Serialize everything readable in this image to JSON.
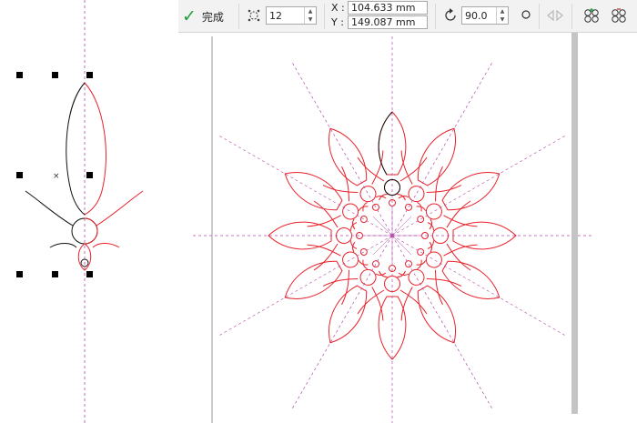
{
  "toolbar": {
    "done_label": "完成",
    "count_value": "12",
    "x_label": "X :",
    "x_value": "104.633 mm",
    "y_label": "Y :",
    "y_value": "149.087 mm",
    "angle_value": "90.0"
  },
  "icons": {
    "done": "checkmark-icon",
    "count": "rotational-copies-icon",
    "rotate": "rotate-icon",
    "circle": "circle-mode-icon",
    "mirror": "mirror-icon",
    "add_object": "add-object-icon",
    "remove_object": "remove-object-icon"
  },
  "colors": {
    "accent_green": "#1e9e3c",
    "guide_magenta": "#b04aa8",
    "copy_red": "#e8202a",
    "original_black": "#111111"
  }
}
